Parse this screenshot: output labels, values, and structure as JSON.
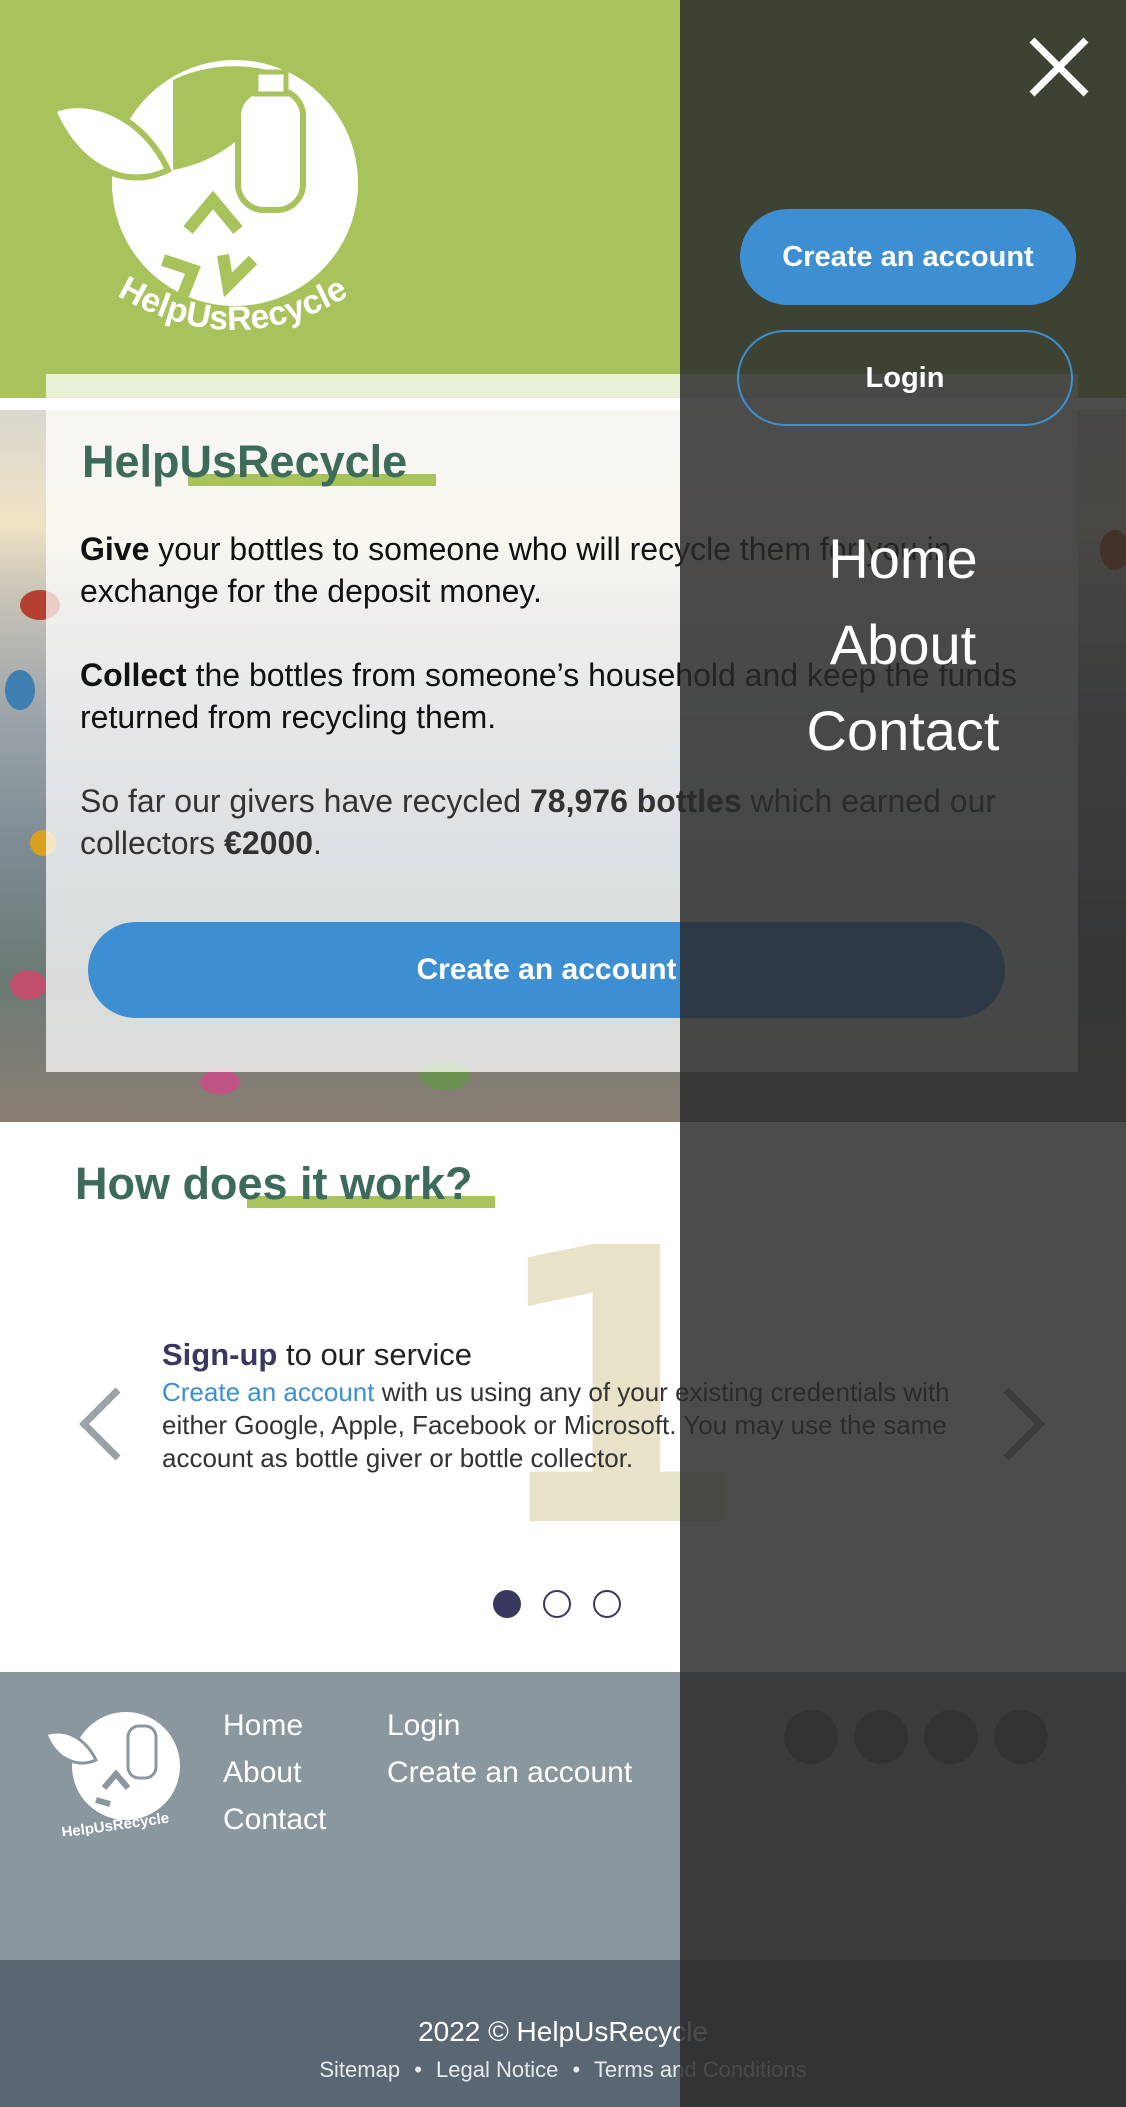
{
  "brand": {
    "name": "HelpUsRecycle"
  },
  "colors": {
    "green": "#a8c25c",
    "teal": "#3d6b5a",
    "blue": "#3d8fd1",
    "navy": "#3b3860"
  },
  "hero": {
    "title": "HelpUsRecycle",
    "give_bold": "Give",
    "give_text": " your bottles to someone who will recycle them for you in exchange for the deposit money.",
    "collect_bold": "Collect",
    "collect_text": " the bottles from someone’s household and keep the funds returned from recycling them.",
    "stats_pre": "So far our givers have recycled ",
    "stats_bottles": "78,976 bottles",
    "stats_mid": " which earned our collectors ",
    "stats_money": "€2000",
    "stats_end": ".",
    "cta": "Create an account"
  },
  "how": {
    "title": "How does it work?",
    "step_number": "1",
    "step_title_bold": "Sign-up",
    "step_title_rest": " to our service",
    "step_link": "Create an account",
    "step_text": " with us using any of your existing credentials with either Google, Apple, Facebook or Microsoft. You may use the same account as bottle giver or bottle collector.",
    "slide_count": 3,
    "active_slide": 1
  },
  "footer": {
    "col1": [
      "Home",
      "About",
      "Contact"
    ],
    "col2": [
      "Login",
      "Create an account"
    ],
    "socials": [
      "twitter-icon",
      "facebook-icon",
      "youtube-icon",
      "instagram-icon"
    ],
    "copyright": "2022 © HelpUsRecycle",
    "legal": [
      "Sitemap",
      "Legal Notice",
      "Terms and Conditions"
    ],
    "separator": "•"
  },
  "drawer": {
    "create": "Create an account",
    "login": "Login",
    "nav": [
      "Home",
      "About",
      "Contact"
    ]
  }
}
